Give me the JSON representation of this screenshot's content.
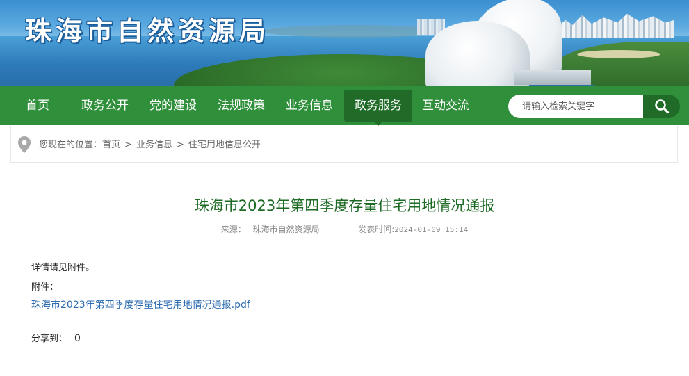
{
  "site": {
    "title": "珠海市自然资源局"
  },
  "nav": {
    "items": [
      {
        "label": "首页"
      },
      {
        "label": "政务公开"
      },
      {
        "label": "党的建设"
      },
      {
        "label": "法规政策"
      },
      {
        "label": "业务信息"
      },
      {
        "label": "政务服务",
        "active": true
      },
      {
        "label": "互动交流"
      }
    ],
    "search_placeholder": "请输入检索关键字",
    "search_icon": "search-icon"
  },
  "breadcrumb": {
    "prefix": "您现在的位置：",
    "items": [
      "首页",
      "业务信息",
      "住宅用地信息公开"
    ],
    "separator": ">"
  },
  "article": {
    "title": "珠海市2023年第四季度存量住宅用地情况通报",
    "source_label": "来源：",
    "source": "珠海市自然资源局",
    "time_label": "发表时间:",
    "time": "2024-01-09 15:14",
    "body": "详情请见附件。",
    "attachment_label": "附件：",
    "attachment_name": "珠海市2023年第四季度存量住宅用地情况通报.pdf"
  },
  "share": {
    "label": "分享到：",
    "count": "0"
  },
  "colors": {
    "nav_green": "#2f8f3a",
    "nav_active": "#1f6b27",
    "title_green": "#1d6a24",
    "link_blue": "#2b6cb0"
  }
}
